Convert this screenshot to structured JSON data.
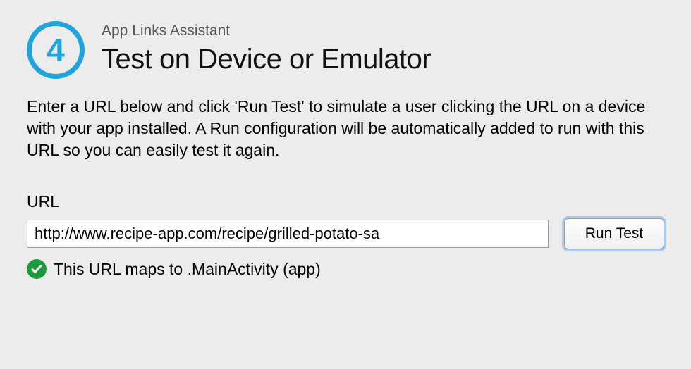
{
  "header": {
    "step_number": "4",
    "subtitle": "App Links Assistant",
    "title": "Test on Device or Emulator"
  },
  "description": "Enter a URL below and click 'Run Test' to simulate a user clicking the URL on a device with your app installed. A Run configuration will be automatically added to run with this URL so you can easily test it again.",
  "url_section": {
    "label": "URL",
    "value": "http://www.recipe-app.com/recipe/grilled-potato-sa",
    "button_label": "Run Test"
  },
  "status": {
    "text": "This URL maps to .MainActivity (app)"
  }
}
